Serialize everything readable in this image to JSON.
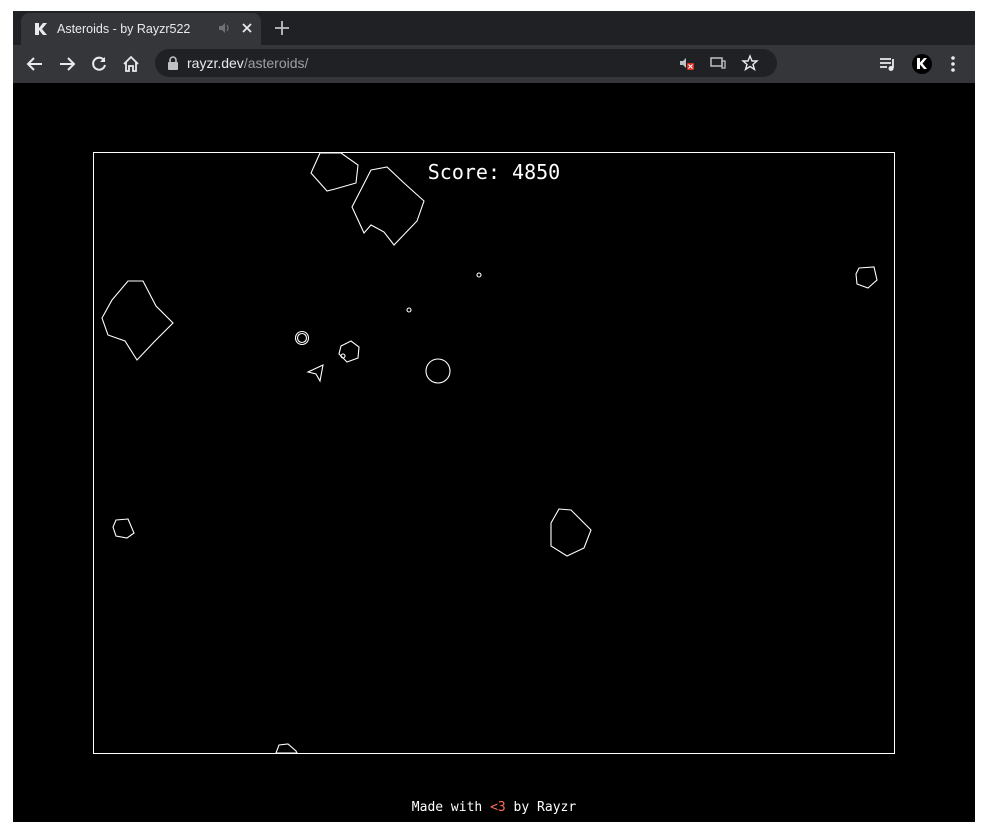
{
  "browser": {
    "tab": {
      "title": "Asteroids - by Rayzr522",
      "favicon": "rayzr-logo-icon",
      "audio_icon": "speaker-icon",
      "close_icon": "close-icon"
    },
    "new_tab_icon": "plus-icon",
    "nav": {
      "back": "back-arrow-icon",
      "forward": "forward-arrow-icon",
      "reload": "reload-icon",
      "home": "home-icon"
    },
    "omnibox": {
      "host": "rayzr.dev",
      "path": "/asteroids/",
      "lock_icon": "lock-icon",
      "sound_blocked_icon": "sound-blocked-icon",
      "cast_icon": "cast-icon",
      "bookmark_icon": "star-icon"
    },
    "toolbar_right": {
      "media": "media-controls-icon",
      "profile": "profile-avatar-icon",
      "menu": "more-vert-icon"
    },
    "colors": {
      "tabstrip": "#202124",
      "toolbar": "#35363a",
      "omnibox": "#202124"
    }
  },
  "game": {
    "score_label": "Score: 4850",
    "background": "#000000",
    "stroke": "#ffffff"
  },
  "footer": {
    "prefix": "Made with ",
    "heart": "<3",
    "suffix": " by Rayzr",
    "heart_color": "#ff6e5a"
  }
}
